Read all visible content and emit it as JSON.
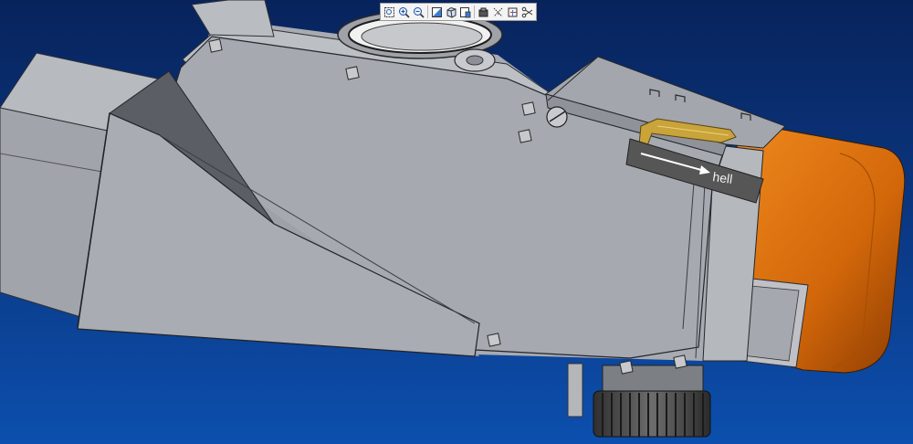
{
  "viewport": {
    "label_tag_text": "hell",
    "colors": {
      "background_top": "#09245e",
      "background_bottom": "#0a4aa3",
      "model_gray": "#a6a9af",
      "model_gray_light": "#bcbec3",
      "model_gray_dark": "#8b8e94",
      "orange_part": "#d86f0a",
      "yellow_part": "#c9a43a",
      "label_tag": "#565656"
    }
  },
  "toolbar": {
    "icons": [
      "zoom-window-icon",
      "zoom-in-icon",
      "zoom-out-icon",
      "refit-icon",
      "view-orientation-icon",
      "saved-views-icon",
      "layers-icon",
      "datum-display-icon",
      "spin-center-icon",
      "annotation-display-icon"
    ]
  }
}
